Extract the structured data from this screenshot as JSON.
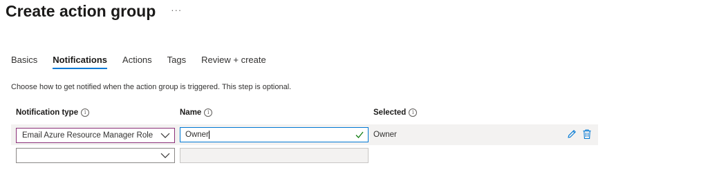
{
  "page": {
    "title": "Create action group",
    "more_label": "···"
  },
  "tabs": [
    {
      "label": "Basics",
      "active": false
    },
    {
      "label": "Notifications",
      "active": true
    },
    {
      "label": "Actions",
      "active": false
    },
    {
      "label": "Tags",
      "active": false
    },
    {
      "label": "Review + create",
      "active": false
    }
  ],
  "description": "Choose how to get notified when the action group is triggered. This step is optional.",
  "columns": {
    "notification_type": "Notification type",
    "name": "Name",
    "selected": "Selected",
    "info_glyph": "i"
  },
  "rows": [
    {
      "notification_type": "Email Azure Resource Manager Role",
      "name": "Owner",
      "selected": "Owner"
    },
    {
      "notification_type": "",
      "name": "",
      "selected": ""
    }
  ],
  "colors": {
    "accent": "#0078d4",
    "focus_border": "#8a2f78",
    "row_bg": "#f3f2f1",
    "valid_check": "#107c10"
  },
  "icons": [
    "more-icon",
    "info-icon",
    "chevron-down-icon",
    "checkmark-icon",
    "edit-icon",
    "delete-icon"
  ]
}
